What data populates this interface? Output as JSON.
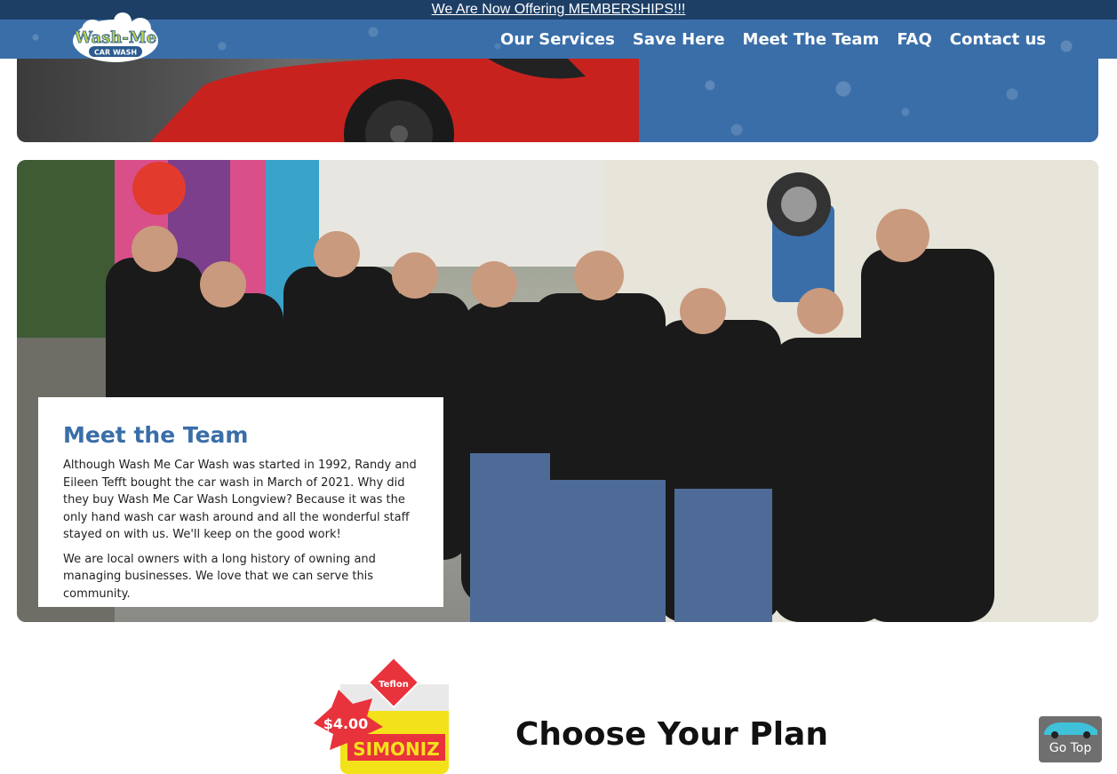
{
  "promo": {
    "text": "We Are Now Offering MEMBERSHIPS!!!"
  },
  "header": {
    "logo_text_1": "Wash-Me",
    "logo_text_2": "CAR WASH",
    "nav": [
      {
        "label": "Our Services"
      },
      {
        "label": "Save Here"
      },
      {
        "label": "Meet The Team"
      },
      {
        "label": "FAQ"
      },
      {
        "label": "Contact us"
      }
    ]
  },
  "team": {
    "title": "Meet the Team",
    "paragraphs": [
      "Although Wash Me Car Wash was started in 1992, Randy and Eileen Tefft bought the car wash in March of 2021. Why did they buy Wash Me Car Wash Longview? Because it was the only hand wash car wash around and all the wonderful staff stayed on with us. We'll keep on the good work!",
      "We are local owners with a long history of owning and managing businesses. We love that we can serve this community."
    ]
  },
  "plans": {
    "title": "Choose Your Plan",
    "product_price": "$4.00",
    "product_brand": "SIMONIZ",
    "product_badge": "Teflon"
  },
  "go_top": {
    "label": "Go Top"
  },
  "colors": {
    "primary_blue": "#3a6ea8",
    "promo_bar": "#1d3f66"
  }
}
